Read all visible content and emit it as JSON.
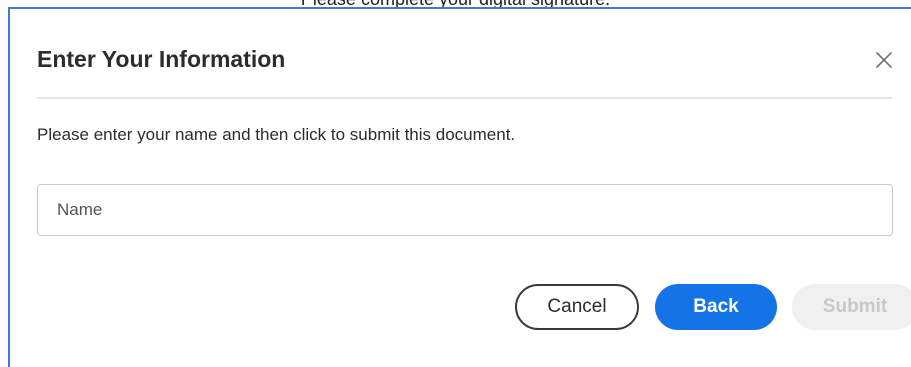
{
  "background_text": "Please complete your digital signature.",
  "dialog": {
    "title": "Enter Your Information",
    "instructions": "Please enter your name and then click to submit this document.",
    "name_field": {
      "placeholder": "Name",
      "value": ""
    },
    "buttons": {
      "cancel": "Cancel",
      "back": "Back",
      "submit": "Submit"
    }
  },
  "colors": {
    "primary_button": "#1473e6",
    "disabled_button_bg": "#f0f0f0",
    "dialog_border": "#4a78c8"
  },
  "icons": {
    "close": "close-icon"
  }
}
